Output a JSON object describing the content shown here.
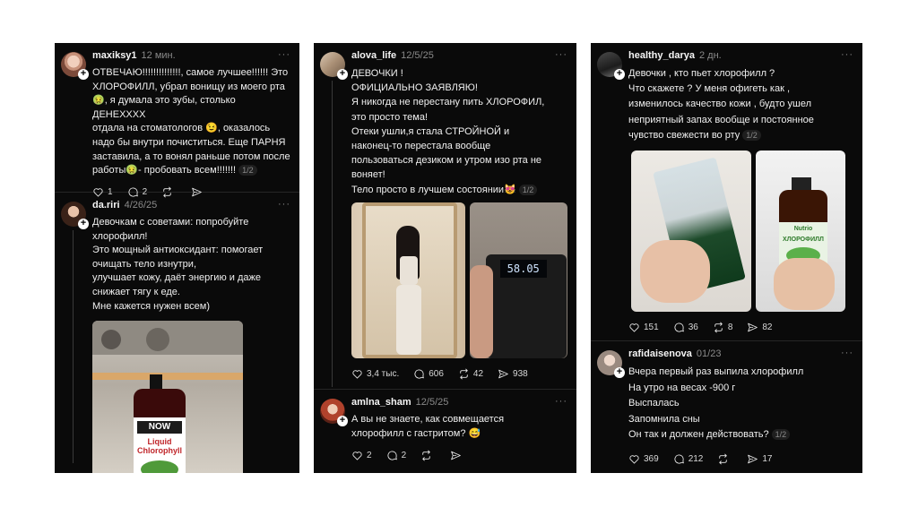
{
  "cards": [
    {
      "posts": [
        {
          "username": "maxiksy1",
          "time": "12 мин.",
          "lines": [
            "ОТВЕЧАЮ!!!!!!!!!!!!!!, самое лучшее!!!!!! Это",
            "ХЛОРОФИЛЛ, убрал вонищу из моего рта",
            "🤢, я думала это зубы, столько ДЕНЕХХХХ",
            "отдала на стоматологов 😉, оказалось",
            "надо бы внутри почиститься. Еще ПАРНЯ",
            "заставила, а то вонял раньше потом после",
            "работы🤢- пробовать всем!!!!!!!"
          ],
          "page": "1/2",
          "likes": "1",
          "comments": "2",
          "reposts": "",
          "shares": ""
        },
        {
          "username": "da.riri",
          "time": "4/26/25",
          "lines": [
            "Девочкам с советами: попробуйте",
            "хлорофилл!",
            "Это мощный антиоксидант: помогает",
            "очищать тело изнутри,",
            "улучшает кожу, даёт энергию и даже",
            "снижает тягу к еде.",
            "Мне кажется нужен всем)"
          ],
          "bottle_brand": "NOW",
          "bottle_label": "Liquid Chlorophyll"
        }
      ]
    },
    {
      "posts": [
        {
          "username": "alova_life",
          "time": "12/5/25",
          "lines": [
            "ДЕВОЧКИ !",
            "ОФИЦИАЛЬНО ЗАЯВЛЯЮ!",
            "Я никогда не перестану пить ХЛОРОФИЛ,",
            "это просто тема!",
            "Отеки ушли,я стала СТРОЙНОЙ  и",
            "наконец-то перестала вообще",
            "пользоваться дезиком и утром изо рта не",
            "воняет!",
            "Тело просто в лучшем состоянии😻"
          ],
          "page": "1/2",
          "scale_reading": "58.05",
          "likes": "3,4 тыс.",
          "comments": "606",
          "reposts": "42",
          "shares": "938"
        },
        {
          "username": "amlna_sham",
          "time": "12/5/25",
          "lines": [
            "А вы не знаете, как совмещается",
            "хлорофилл с гастритом? 😅"
          ],
          "likes": "2",
          "comments": "2",
          "reposts": "",
          "shares": ""
        }
      ]
    },
    {
      "posts": [
        {
          "username": "healthy_darya",
          "time": "2 дн.",
          "lines": [
            "Девочки , кто пьет хлорофилл ?",
            "Что скажете ? У меня офигеть как ,",
            "изменилось качество кожи , будто ушел",
            "неприятный запах вообще и постоянное",
            "чувство свежести во рту"
          ],
          "page": "1/2",
          "bottle_brand": "Nutrio",
          "bottle_label": "ХЛОРОФИЛЛ",
          "likes": "151",
          "comments": "36",
          "reposts": "8",
          "shares": "82"
        },
        {
          "username": "rafidaisenova",
          "time": "01/23",
          "lines": [
            "Вчера первый раз выпила хлорофилл",
            "На утро на весах -900 г",
            "Выспалась",
            "Запомнила сны",
            "Он так и должен действовать?"
          ],
          "page": "1/2",
          "likes": "369",
          "comments": "212",
          "reposts": "",
          "shares": "17"
        }
      ]
    }
  ],
  "more_label": "···"
}
